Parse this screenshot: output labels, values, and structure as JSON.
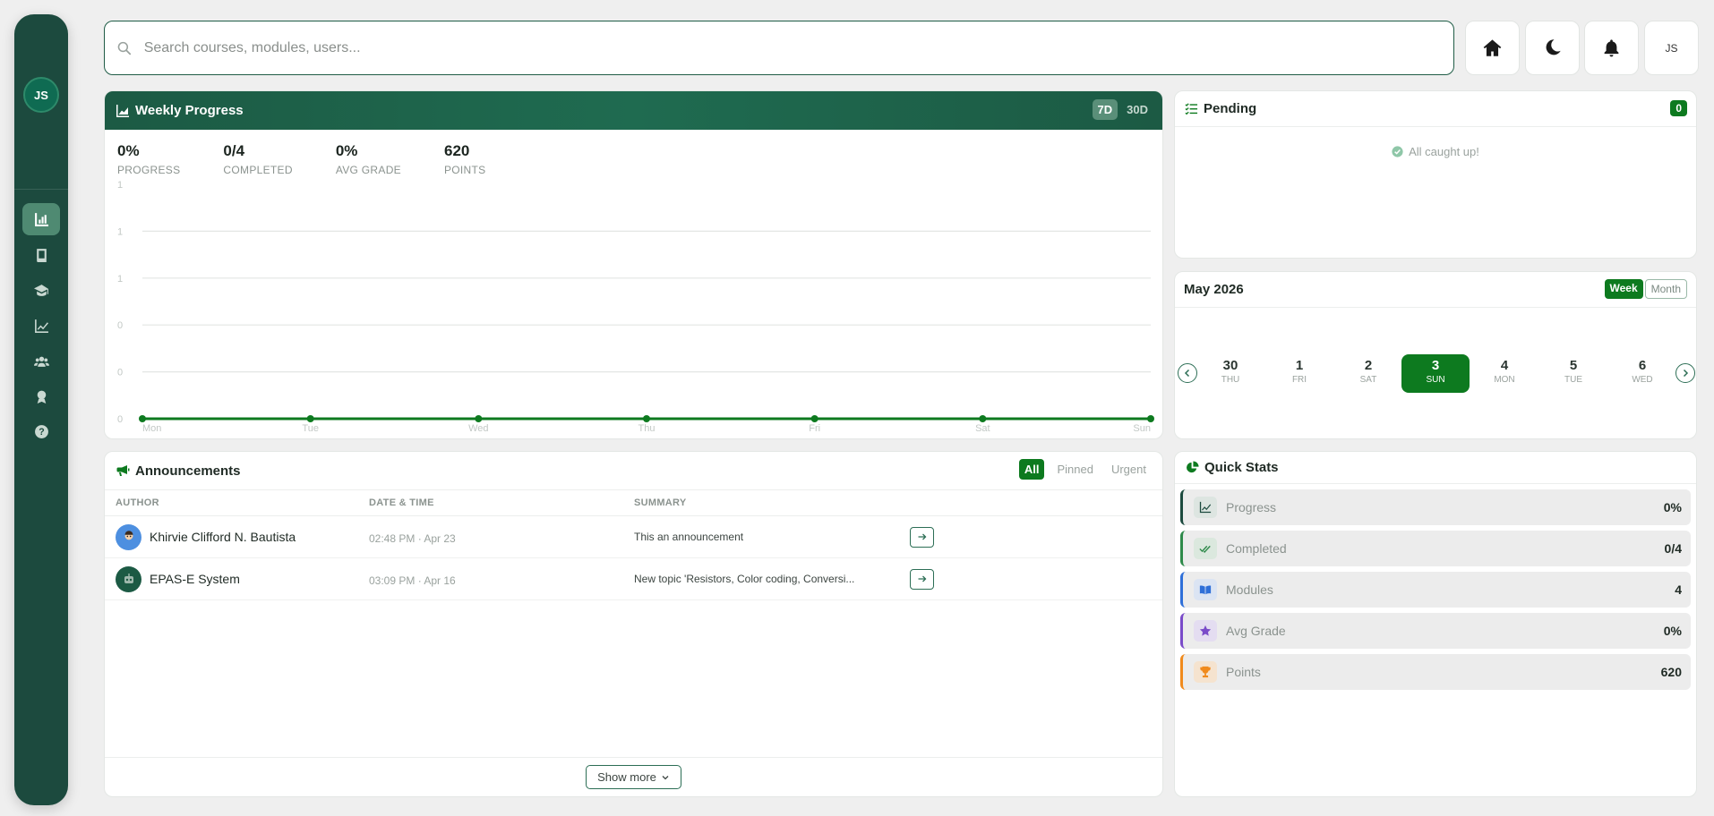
{
  "sidebar": {
    "avatar_initials": "JS",
    "items": [
      {
        "icon": "chart-bar-icon",
        "active": true
      },
      {
        "icon": "book-icon",
        "active": false
      },
      {
        "icon": "graduation-cap-icon",
        "active": false
      },
      {
        "icon": "line-chart-icon",
        "active": false
      },
      {
        "icon": "users-icon",
        "active": false
      },
      {
        "icon": "award-icon",
        "active": false
      },
      {
        "icon": "help-icon",
        "active": false
      }
    ]
  },
  "search": {
    "placeholder": "Search courses, modules, users..."
  },
  "topbar": {
    "profile_initials": "JS"
  },
  "weekly": {
    "title": "Weekly Progress",
    "tabs": [
      "7D",
      "30D"
    ],
    "kpis": [
      {
        "value": "0%",
        "label": "PROGRESS"
      },
      {
        "value": "0/4",
        "label": "COMPLETED"
      },
      {
        "value": "0%",
        "label": "AVG GRADE"
      },
      {
        "value": "620",
        "label": "POINTS"
      }
    ]
  },
  "chart_data": {
    "type": "line",
    "categories": [
      "Mon",
      "Tue",
      "Wed",
      "Thu",
      "Fri",
      "Sat",
      "Sun"
    ],
    "series": [
      {
        "values": [
          0,
          0,
          0,
          0,
          0,
          0,
          0
        ]
      }
    ],
    "ytick_labels": [
      "1",
      "1",
      "1",
      "0",
      "0",
      "0"
    ],
    "ylim": [
      0,
      1
    ],
    "grid": true,
    "color": "#0d7a1f"
  },
  "pending": {
    "title": "Pending",
    "count": "0",
    "empty_text": "All caught up!"
  },
  "calendar": {
    "title": "May 2026",
    "views": [
      "Week",
      "Month"
    ],
    "days": [
      {
        "num": "30",
        "dow": "THU"
      },
      {
        "num": "1",
        "dow": "FRI"
      },
      {
        "num": "2",
        "dow": "SAT"
      },
      {
        "num": "3",
        "dow": "SUN",
        "selected": true
      },
      {
        "num": "4",
        "dow": "MON"
      },
      {
        "num": "5",
        "dow": "TUE"
      },
      {
        "num": "6",
        "dow": "WED"
      }
    ]
  },
  "announcements": {
    "title": "Announcements",
    "filters": [
      "All",
      "Pinned",
      "Urgent"
    ],
    "columns": [
      "AUTHOR",
      "DATE & TIME",
      "SUMMARY"
    ],
    "rows": [
      {
        "author": "Khirvie Clifford N. Bautista",
        "datetime": "02:48 PM · Apr 23",
        "summary": "This an announcement"
      },
      {
        "author": "EPAS-E System",
        "datetime": "03:09 PM · Apr 16",
        "summary": "New topic 'Resistors, Color coding, Conversi..."
      }
    ],
    "show_more": "Show more"
  },
  "quick_stats": {
    "title": "Quick Stats",
    "items": [
      {
        "label": "Progress",
        "value": "0%",
        "color": "#1c4a3e"
      },
      {
        "label": "Completed",
        "value": "0/4",
        "color": "#2e8a4a"
      },
      {
        "label": "Modules",
        "value": "4",
        "color": "#2f6fd8"
      },
      {
        "label": "Avg Grade",
        "value": "0%",
        "color": "#7a4bc9"
      },
      {
        "label": "Points",
        "value": "620",
        "color": "#f08a1c"
      }
    ]
  }
}
